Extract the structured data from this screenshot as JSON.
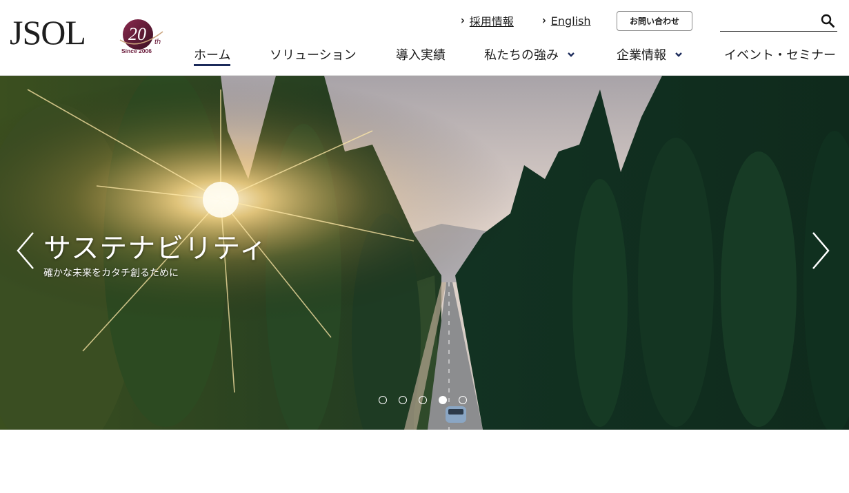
{
  "brand": {
    "logo_text": "JSOL",
    "anniversary_mark": "20",
    "anniversary_suffix": "th",
    "anniversary_since": "Since 2006"
  },
  "utility": {
    "recruit_label": "採用情報",
    "english_label": "English",
    "contact_label": "お問い合わせ",
    "search_placeholder": ""
  },
  "nav": {
    "items": [
      {
        "label": "ホーム",
        "active": true,
        "has_dropdown": false
      },
      {
        "label": "ソリューション",
        "active": false,
        "has_dropdown": false
      },
      {
        "label": "導入実績",
        "active": false,
        "has_dropdown": false
      },
      {
        "label": "私たちの強み",
        "active": false,
        "has_dropdown": true
      },
      {
        "label": "企業情報",
        "active": false,
        "has_dropdown": true
      },
      {
        "label": "イベント・セミナー",
        "active": false,
        "has_dropdown": false
      }
    ]
  },
  "hero": {
    "title": "サステナビリティ",
    "subtitle": "確かな未来をカタチ創るために",
    "slide_count": 5,
    "active_slide": 4
  },
  "colors": {
    "nav_active_underline": "#1b2a5a",
    "badge_maroon": "#6a1a3a",
    "text": "#1a1a1a"
  },
  "icons": {
    "search": "search-icon",
    "prev": "chevron-left-icon",
    "next": "chevron-right-icon",
    "caret": "chevron-down-icon"
  }
}
